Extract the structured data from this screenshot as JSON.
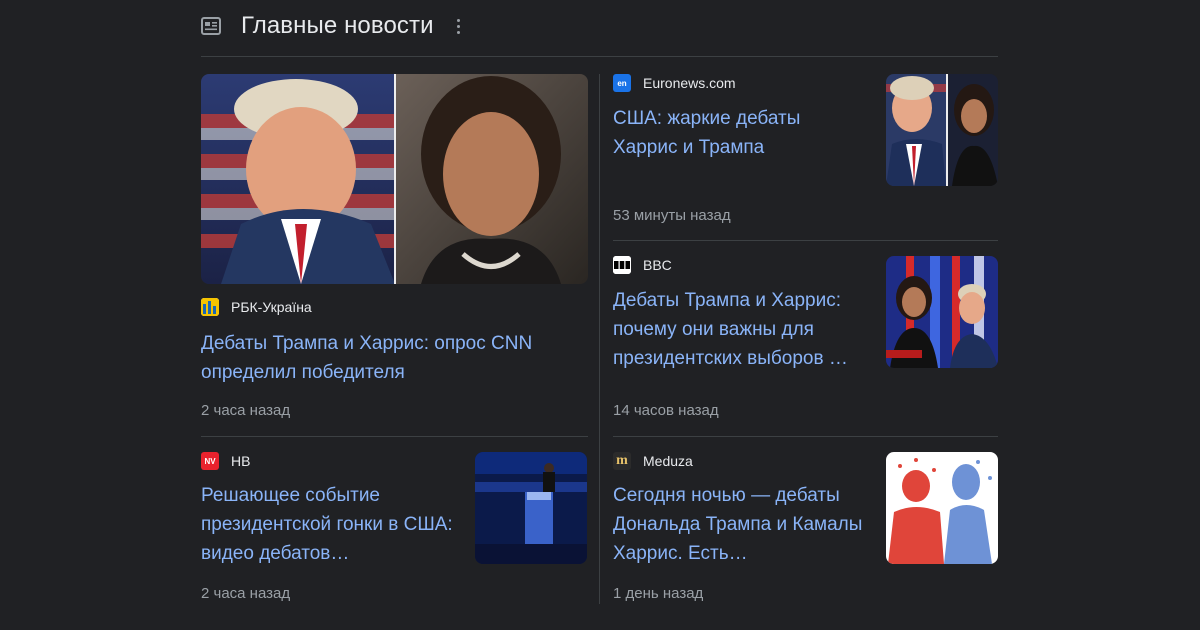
{
  "header": {
    "title": "Главные новости",
    "icon": "news-icon",
    "more_icon": "more-vert-icon"
  },
  "featured": {
    "source": "РБК-Україна",
    "headline": "Дебаты Трампа и Харрис: опрос CNN определил победителя",
    "time": "2 часа назад"
  },
  "left_small": {
    "source": "НВ",
    "headline": "Решающее событие президентской гонки в США: видео дебатов…",
    "time": "2 часа назад"
  },
  "right_items": [
    {
      "source": "Euronews.com",
      "headline": "США: жаркие дебаты Харрис и Трампа",
      "time": "53 минуты назад"
    },
    {
      "source": "BBC",
      "headline": "Дебаты Трампа и Харрис: почему они важны для президентских выборов …",
      "time": "14 часов назад"
    },
    {
      "source": "Meduza",
      "headline": "Сегодня ночью — дебаты Дональда Трампа и Камалы Харрис. Есть…",
      "time": "1 день назад"
    }
  ],
  "logos": {
    "euronews": "en",
    "nv": "NV",
    "meduza": "m"
  },
  "colors": {
    "background": "#202124",
    "link": "#8ab4f8",
    "meta": "#9aa0a6"
  }
}
